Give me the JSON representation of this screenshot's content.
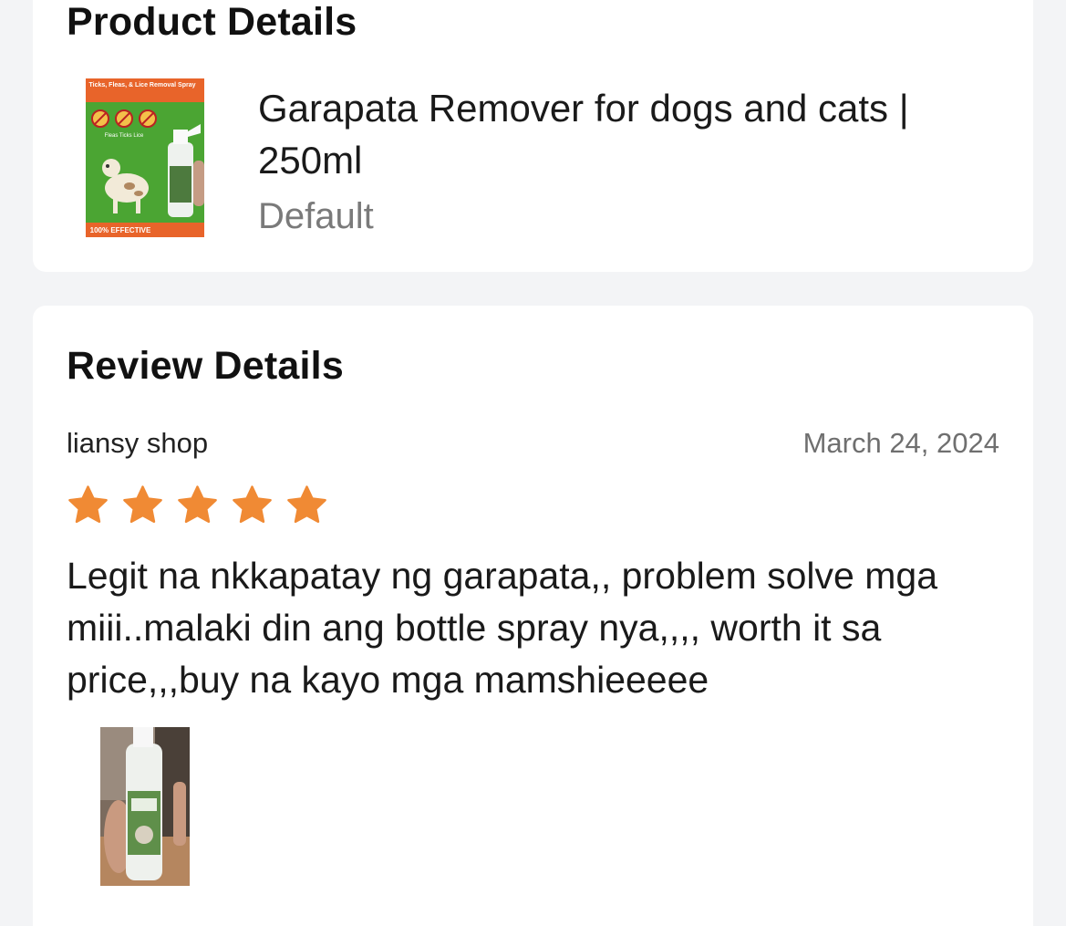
{
  "product_section": {
    "title": "Product Details",
    "product": {
      "name": "Garapata Remover for dogs and cats | 250ml",
      "variant": "Default",
      "thumbnail": {
        "banner_text": "Ticks, Fleas, & Lice Removal Spray",
        "labels_text": "Fleas  Ticks  Lice",
        "badge_text": "100% EFFECTIVE"
      }
    }
  },
  "review_section": {
    "title": "Review Details",
    "reviewer": "liansy shop",
    "date": "March 24, 2024",
    "rating": 5,
    "rating_max": 5,
    "text": "Legit na nkkapatay ng garapata,, problem solve mga miii..malaki din ang bottle spray nya,,,, worth it sa price,,,buy na kayo mga mamshieeeee"
  },
  "colors": {
    "page_background": "#f3f4f6",
    "card_background": "#ffffff",
    "star": "#f08a34",
    "muted_text": "#7a7a7a"
  },
  "icons": {
    "star": "star-icon"
  }
}
